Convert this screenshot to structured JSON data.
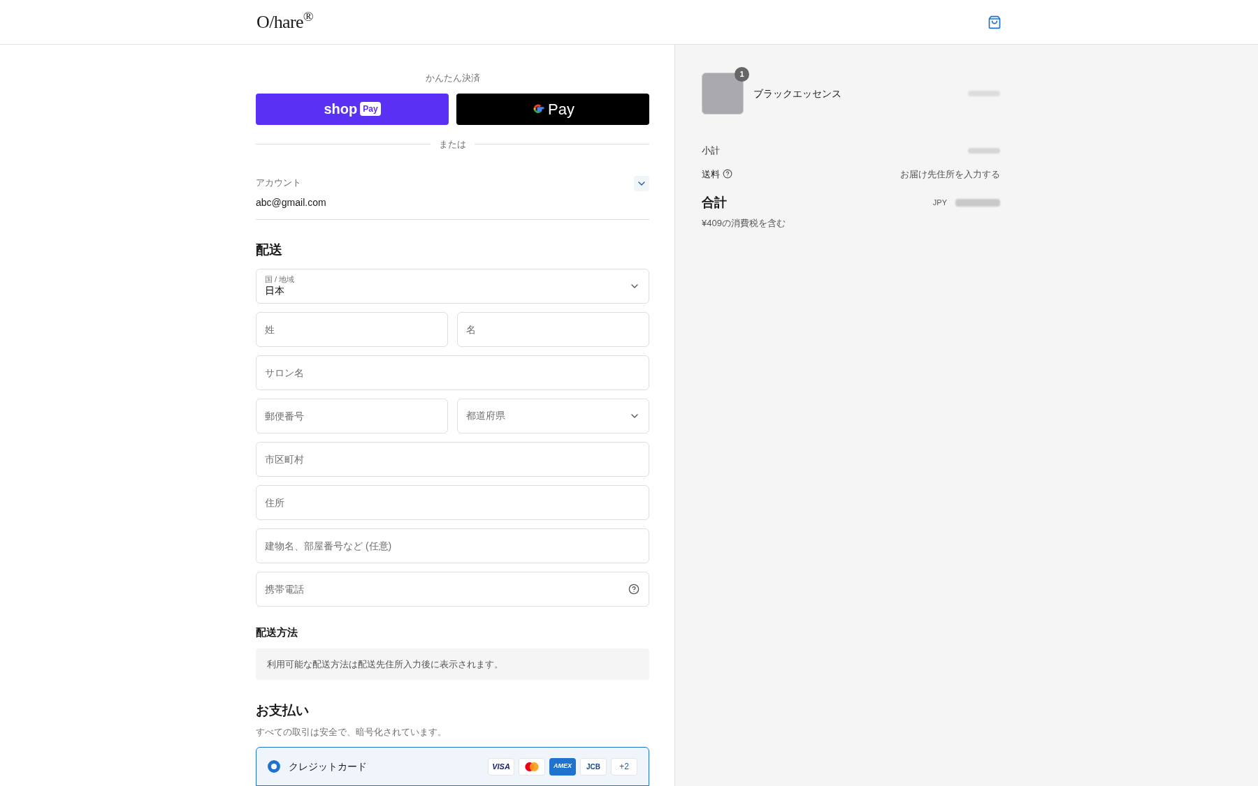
{
  "header": {
    "logo": "O/hare$^{®}$"
  },
  "express": {
    "title": "かんたん決済",
    "buttons": [
      {
        "kind": "shoppay",
        "label": "shop",
        "badge": "Pay"
      },
      {
        "kind": "gpay",
        "label": "Pay"
      }
    ],
    "separator": "または"
  },
  "account": {
    "label": "アカウント",
    "email": "abc@gmail.com"
  },
  "shipping": {
    "title": "配送",
    "rows": [
      [
        {
          "kind": "select",
          "label": "国 / 地域",
          "value": "日本"
        }
      ],
      [
        {
          "kind": "text",
          "placeholder": "姓"
        },
        {
          "kind": "text",
          "placeholder": "名"
        }
      ],
      [
        {
          "kind": "text",
          "placeholder": "サロン名"
        }
      ],
      [
        {
          "kind": "text",
          "placeholder": "郵便番号"
        },
        {
          "kind": "select",
          "placeholder": "都道府県"
        }
      ],
      [
        {
          "kind": "text",
          "placeholder": "市区町村"
        }
      ],
      [
        {
          "kind": "text",
          "placeholder": "住所"
        }
      ],
      [
        {
          "kind": "text",
          "placeholder": "建物名、部屋番号など (任意)"
        }
      ],
      [
        {
          "kind": "help",
          "placeholder": "携帯電話"
        }
      ]
    ]
  },
  "shipping_method": {
    "title": "配送方法",
    "note": "利用可能な配送方法は配送先住所入力後に表示されます。"
  },
  "payment": {
    "title": "お支払い",
    "subtitle": "すべての取引は安全で、暗号化されています。",
    "options": [
      {
        "label": "クレジットカード",
        "selected": true
      }
    ],
    "cards": [
      {
        "kind": "visa",
        "label": "VISA"
      },
      {
        "kind": "mastercard"
      },
      {
        "kind": "amex",
        "label": "AMEX"
      },
      {
        "kind": "jcb",
        "label": "JCB"
      },
      {
        "kind": "more",
        "label": "+2"
      }
    ]
  },
  "summary": {
    "product": {
      "name": "ブラックエッセンス",
      "quantity": "1"
    },
    "subtotal_label": "小計",
    "shipping_label": "送料",
    "shipping_value": "お届け先住所を入力する",
    "total_label": "合計",
    "currency": "JPY",
    "tax_note": "¥409の消費税を含む"
  }
}
